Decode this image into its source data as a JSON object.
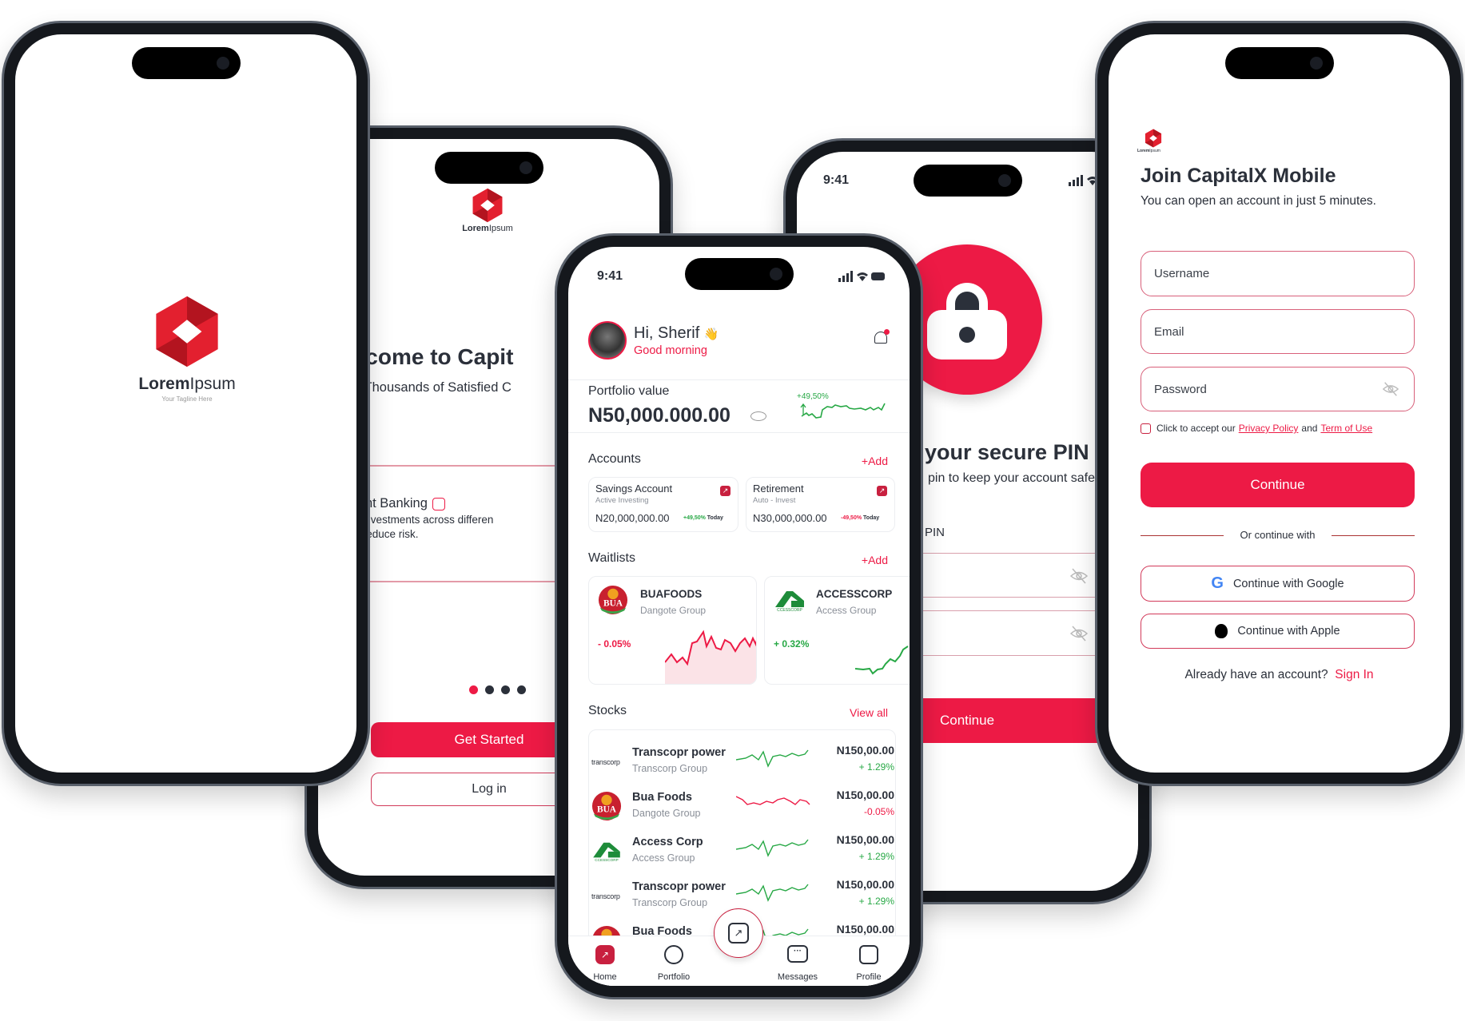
{
  "brand": {
    "name_bold": "Lorem",
    "name_light": "Ipsum",
    "tagline": "Your Tagline Here",
    "accent": "#ED1A45",
    "positive": "#27A845",
    "dark": "#2B303A"
  },
  "splash": {},
  "onboarding": {
    "title": "Welcome to Capit",
    "subtitle": "Join Thousands of Satisfied C",
    "feature_title": "Investment Banking",
    "feature_line1": "Spreading investments across differen",
    "feature_line2": "classes to reduce risk.",
    "dots_active": 1,
    "dots_total": 4,
    "get_started": "Get Started",
    "login": "Log in"
  },
  "home": {
    "status_time": "9:41",
    "greeting": "Hi, Sherif",
    "greeting_emoji": "👋",
    "subgreeting": "Good morning",
    "portfolio_label": "Portfolio value",
    "portfolio_value": "N50,000.000.00",
    "portfolio_change": "+49,50%",
    "accounts_title": "Accounts",
    "add_label": "+Add",
    "accounts": [
      {
        "name": "Savings Account",
        "type": "Active Investing",
        "amount": "N20,000,000.00",
        "change": "+49,50%",
        "period": "Today",
        "trend": "up"
      },
      {
        "name": "Retirement",
        "type": "Auto - Invest",
        "amount": "N30,000,000.00",
        "change": "-49,50%",
        "period": "Today",
        "trend": "down"
      }
    ],
    "waitlists_title": "Waitlists",
    "waitlists": [
      {
        "ticker": "BUAFOODS",
        "group": "Dangote Group",
        "change": "- 0.05%",
        "logo": "BUA",
        "trend": "down"
      },
      {
        "ticker": "ACCESSCORP",
        "group": "Access Group",
        "change": "+ 0.32%",
        "logo": "access",
        "trend": "up"
      }
    ],
    "stocks_title": "Stocks",
    "view_all": "View all",
    "stocks": [
      {
        "name": "Transcopr power",
        "group": "Transcorp Group",
        "price": "N150,00.00",
        "change": "+ 1.29%",
        "logo": "transcorp",
        "trend": "up"
      },
      {
        "name": "Bua Foods",
        "group": "Dangote Group",
        "price": "N150,00.00",
        "change": "-0.05%",
        "logo": "BUA",
        "trend": "down"
      },
      {
        "name": "Access Corp",
        "group": "Access Group",
        "price": "N150,00.00",
        "change": "+ 1.29%",
        "logo": "access",
        "trend": "up"
      },
      {
        "name": "Transcopr power",
        "group": "Transcorp Group",
        "price": "N150,00.00",
        "change": "+ 1.29%",
        "logo": "transcorp",
        "trend": "up"
      },
      {
        "name": "Bua Foods",
        "group": "",
        "price": "N150,00.00",
        "change": "",
        "logo": "BUA",
        "trend": "up"
      }
    ],
    "logo_text": {
      "transcorp": "transcorp",
      "access": "CCESSCORP",
      "bua": "BUA"
    },
    "nav": [
      {
        "label": "Home",
        "icon": "home-chart-icon",
        "active": true
      },
      {
        "label": "Portfolio",
        "icon": "pie-chart-icon"
      },
      {
        "label": "",
        "icon": "trade-chart-icon"
      },
      {
        "label": "Messages",
        "icon": "chat-icon"
      },
      {
        "label": "Profile",
        "icon": "profile-icon"
      }
    ]
  },
  "pin": {
    "status_time": "9:41",
    "title": "your secure PIN",
    "subtitle": "pin to keep your account safe.",
    "pin_label": "PIN",
    "continue": "Continue"
  },
  "signup": {
    "title": "Join CapitalX Mobile",
    "subtitle": "You can open an account in just 5 minutes.",
    "username_placeholder": "Username",
    "email_placeholder": "Email",
    "password_placeholder": "Password",
    "terms_prefix": "Click to accept our",
    "privacy": "Privacy Policy",
    "and": "and",
    "terms": "Term of Use",
    "continue": "Continue",
    "divider": "Or continue with",
    "google": "Continue with Google",
    "apple": "Continue with Apple",
    "have_account": "Already have an account?",
    "sign_in": "Sign In"
  }
}
